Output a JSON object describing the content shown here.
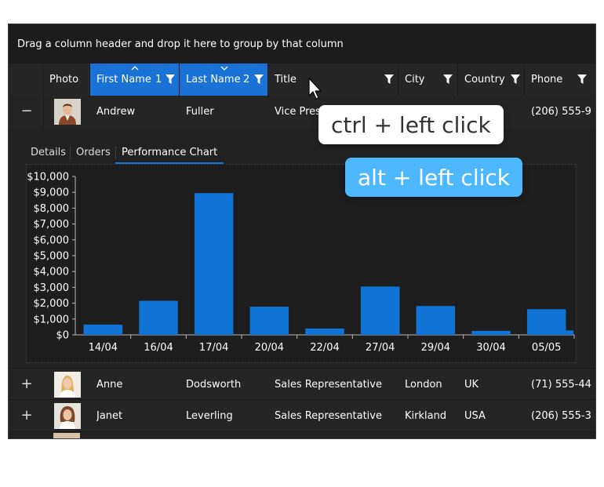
{
  "group_panel": {
    "text": "Drag a column header and drop it here to group by that column"
  },
  "columns": [
    {
      "label": "Photo",
      "sorted": false
    },
    {
      "label": "First Name",
      "sorted": true,
      "sort_index": "1",
      "sort_dir": "ascending",
      "filter": true
    },
    {
      "label": "Last Name",
      "sorted": true,
      "sort_index": "2",
      "sort_dir": "descending",
      "filter": true
    },
    {
      "label": "Title",
      "sorted": false,
      "filter": true
    },
    {
      "label": "City",
      "sorted": false,
      "filter": true
    },
    {
      "label": "Country",
      "sorted": false,
      "filter": true
    },
    {
      "label": "Phone",
      "sorted": false,
      "filter": true
    }
  ],
  "rows": [
    {
      "expander": "−",
      "first": "Andrew",
      "last": "Fuller",
      "title": "Vice Pres",
      "city": "",
      "country": "",
      "phone": "(206) 555-9",
      "expanded": true
    },
    {
      "expander": "+",
      "first": "Anne",
      "last": "Dodsworth",
      "title": "Sales Representative",
      "city": "London",
      "country": "UK",
      "phone": "(71) 555-44",
      "expanded": false
    },
    {
      "expander": "+",
      "first": "Janet",
      "last": "Leverling",
      "title": "Sales Representative",
      "city": "Kirkland",
      "country": "USA",
      "phone": "(206) 555-3",
      "expanded": false
    }
  ],
  "detail_tabs": [
    {
      "label": "Details",
      "selected": false
    },
    {
      "label": "Orders",
      "selected": false
    },
    {
      "label": "Performance Chart",
      "selected": true
    }
  ],
  "tooltips": {
    "ctrl": "ctrl + left click",
    "alt": "alt + left click"
  },
  "colors": {
    "accent": "#1a72d6",
    "bar": "#0f74d6",
    "alt_tip": "#4db8ff",
    "background": "#222222"
  },
  "chart_data": {
    "type": "bar",
    "categories": [
      "14/04",
      "16/04",
      "17/04",
      "20/04",
      "22/04",
      "27/04",
      "29/04",
      "30/04",
      "05/05"
    ],
    "values": [
      650,
      2150,
      8950,
      1780,
      400,
      3050,
      1820,
      250,
      1620
    ],
    "extra_bar": {
      "after": "05/05",
      "value": 280
    },
    "yticks": [
      "$0",
      "$1,000",
      "$2,000",
      "$3,000",
      "$4,000",
      "$5,000",
      "$6,000",
      "$7,000",
      "$8,000",
      "$9,000",
      "$10,000"
    ],
    "ylim": [
      0,
      10000
    ],
    "xlabel": "",
    "ylabel": "",
    "title": "",
    "grid": false
  }
}
